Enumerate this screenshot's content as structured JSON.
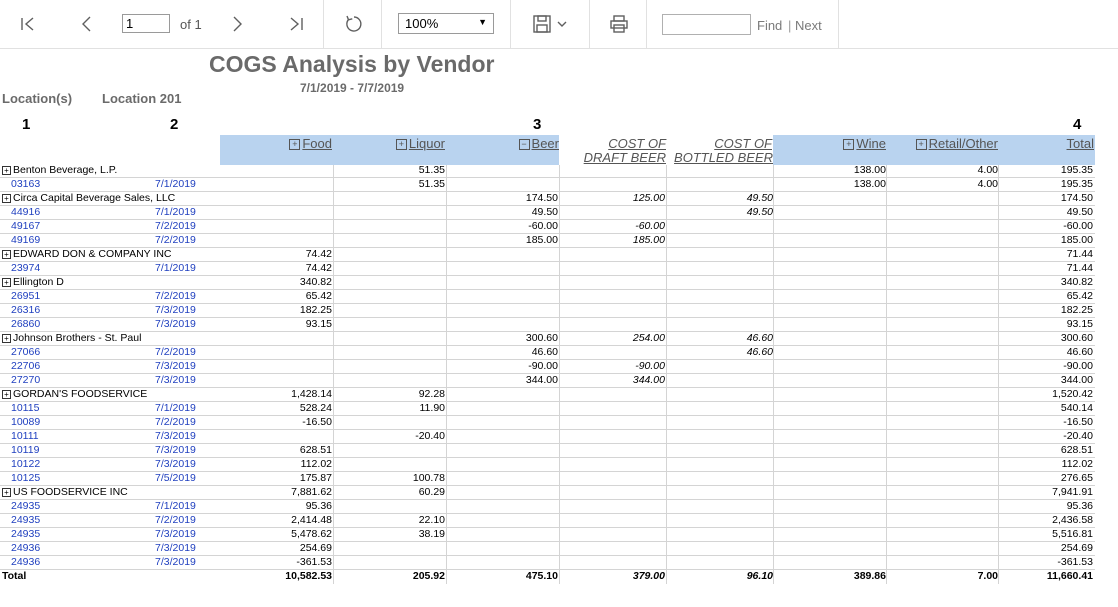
{
  "toolbar": {
    "page_value": "1",
    "of_label": "of 1",
    "zoom_value": "100%",
    "find_label": "Find",
    "separator": "|",
    "next_label": "Next"
  },
  "report": {
    "title": "COGS Analysis by Vendor",
    "daterange": "7/1/2019 - 7/7/2019",
    "location_label": "Location(s)",
    "location_value": "Location  201",
    "callouts": [
      "1",
      "2",
      "3",
      "4"
    ]
  },
  "columns": {
    "food": "Food",
    "liquor": "Liquor",
    "beer": "Beer",
    "draft_line1": "COST OF",
    "draft_line2": "DRAFT BEER",
    "bottled_line1": "COST OF",
    "bottled_line2": "BOTTLED BEER",
    "wine": "Wine",
    "retail": "Retail/Other",
    "total": "Total",
    "plus": "+",
    "minus": "−"
  },
  "rows": [
    {
      "kind": "vendor",
      "label": "Benton Beverage, L.P.",
      "food": "",
      "liquor": "51.35",
      "beer": "",
      "draft": "",
      "bottled": "",
      "wine": "138.00",
      "retail": "4.00",
      "total": "195.35"
    },
    {
      "kind": "detail",
      "doc": "03163",
      "date": "7/1/2019",
      "food": "",
      "liquor": "51.35",
      "beer": "",
      "draft": "",
      "bottled": "",
      "wine": "138.00",
      "retail": "4.00",
      "total": "195.35"
    },
    {
      "kind": "vendor",
      "label": "Circa Capital Beverage Sales, LLC",
      "food": "",
      "liquor": "",
      "beer": "174.50",
      "draft": "125.00",
      "bottled": "49.50",
      "wine": "",
      "retail": "",
      "total": "174.50"
    },
    {
      "kind": "detail",
      "doc": "44916",
      "date": "7/1/2019",
      "food": "",
      "liquor": "",
      "beer": "49.50",
      "draft": "",
      "bottled": "49.50",
      "wine": "",
      "retail": "",
      "total": "49.50"
    },
    {
      "kind": "detail",
      "doc": "49167",
      "date": "7/2/2019",
      "food": "",
      "liquor": "",
      "beer": "-60.00",
      "draft": "-60.00",
      "bottled": "",
      "wine": "",
      "retail": "",
      "total": "-60.00"
    },
    {
      "kind": "detail",
      "doc": "49169",
      "date": "7/2/2019",
      "food": "",
      "liquor": "",
      "beer": "185.00",
      "draft": "185.00",
      "bottled": "",
      "wine": "",
      "retail": "",
      "total": "185.00"
    },
    {
      "kind": "vendor",
      "label": "EDWARD DON & COMPANY INC",
      "food": "74.42",
      "liquor": "",
      "beer": "",
      "draft": "",
      "bottled": "",
      "wine": "",
      "retail": "",
      "total": "71.44"
    },
    {
      "kind": "detail",
      "doc": "23974",
      "date": "7/1/2019",
      "food": "74.42",
      "liquor": "",
      "beer": "",
      "draft": "",
      "bottled": "",
      "wine": "",
      "retail": "",
      "total": "71.44"
    },
    {
      "kind": "vendor",
      "label": "Ellington D",
      "food": "340.82",
      "liquor": "",
      "beer": "",
      "draft": "",
      "bottled": "",
      "wine": "",
      "retail": "",
      "total": "340.82"
    },
    {
      "kind": "detail",
      "doc": "26951",
      "date": "7/2/2019",
      "food": "65.42",
      "liquor": "",
      "beer": "",
      "draft": "",
      "bottled": "",
      "wine": "",
      "retail": "",
      "total": "65.42"
    },
    {
      "kind": "detail",
      "doc": "26316",
      "date": "7/3/2019",
      "food": "182.25",
      "liquor": "",
      "beer": "",
      "draft": "",
      "bottled": "",
      "wine": "",
      "retail": "",
      "total": "182.25"
    },
    {
      "kind": "detail",
      "doc": "26860",
      "date": "7/3/2019",
      "food": "93.15",
      "liquor": "",
      "beer": "",
      "draft": "",
      "bottled": "",
      "wine": "",
      "retail": "",
      "total": "93.15"
    },
    {
      "kind": "vendor",
      "label": "Johnson Brothers - St. Paul",
      "food": "",
      "liquor": "",
      "beer": "300.60",
      "draft": "254.00",
      "bottled": "46.60",
      "wine": "",
      "retail": "",
      "total": "300.60"
    },
    {
      "kind": "detail",
      "doc": "27066",
      "date": "7/2/2019",
      "food": "",
      "liquor": "",
      "beer": "46.60",
      "draft": "",
      "bottled": "46.60",
      "wine": "",
      "retail": "",
      "total": "46.60"
    },
    {
      "kind": "detail",
      "doc": "22706",
      "date": "7/3/2019",
      "food": "",
      "liquor": "",
      "beer": "-90.00",
      "draft": "-90.00",
      "bottled": "",
      "wine": "",
      "retail": "",
      "total": "-90.00"
    },
    {
      "kind": "detail",
      "doc": "27270",
      "date": "7/3/2019",
      "food": "",
      "liquor": "",
      "beer": "344.00",
      "draft": "344.00",
      "bottled": "",
      "wine": "",
      "retail": "",
      "total": "344.00"
    },
    {
      "kind": "vendor",
      "label": "GORDAN'S FOODSERVICE",
      "food": "1,428.14",
      "liquor": "92.28",
      "beer": "",
      "draft": "",
      "bottled": "",
      "wine": "",
      "retail": "",
      "total": "1,520.42"
    },
    {
      "kind": "detail",
      "doc": "10115",
      "date": "7/1/2019",
      "food": "528.24",
      "liquor": "11.90",
      "beer": "",
      "draft": "",
      "bottled": "",
      "wine": "",
      "retail": "",
      "total": "540.14"
    },
    {
      "kind": "detail",
      "doc": "10089",
      "date": "7/2/2019",
      "food": "-16.50",
      "liquor": "",
      "beer": "",
      "draft": "",
      "bottled": "",
      "wine": "",
      "retail": "",
      "total": "-16.50"
    },
    {
      "kind": "detail",
      "doc": "10111",
      "date": "7/3/2019",
      "food": "",
      "liquor": "-20.40",
      "beer": "",
      "draft": "",
      "bottled": "",
      "wine": "",
      "retail": "",
      "total": "-20.40"
    },
    {
      "kind": "detail",
      "doc": "10119",
      "date": "7/3/2019",
      "food": "628.51",
      "liquor": "",
      "beer": "",
      "draft": "",
      "bottled": "",
      "wine": "",
      "retail": "",
      "total": "628.51"
    },
    {
      "kind": "detail",
      "doc": "10122",
      "date": "7/3/2019",
      "food": "112.02",
      "liquor": "",
      "beer": "",
      "draft": "",
      "bottled": "",
      "wine": "",
      "retail": "",
      "total": "112.02"
    },
    {
      "kind": "detail",
      "doc": "10125",
      "date": "7/5/2019",
      "food": "175.87",
      "liquor": "100.78",
      "beer": "",
      "draft": "",
      "bottled": "",
      "wine": "",
      "retail": "",
      "total": "276.65"
    },
    {
      "kind": "vendor",
      "label": "US FOODSERVICE INC",
      "food": "7,881.62",
      "liquor": "60.29",
      "beer": "",
      "draft": "",
      "bottled": "",
      "wine": "",
      "retail": "",
      "total": "7,941.91"
    },
    {
      "kind": "detail",
      "doc": "24935",
      "date": "7/1/2019",
      "food": "95.36",
      "liquor": "",
      "beer": "",
      "draft": "",
      "bottled": "",
      "wine": "",
      "retail": "",
      "total": "95.36"
    },
    {
      "kind": "detail",
      "doc": "24935",
      "date": "7/2/2019",
      "food": "2,414.48",
      "liquor": "22.10",
      "beer": "",
      "draft": "",
      "bottled": "",
      "wine": "",
      "retail": "",
      "total": "2,436.58"
    },
    {
      "kind": "detail",
      "doc": "24935",
      "date": "7/3/2019",
      "food": "5,478.62",
      "liquor": "38.19",
      "beer": "",
      "draft": "",
      "bottled": "",
      "wine": "",
      "retail": "",
      "total": "5,516.81"
    },
    {
      "kind": "detail",
      "doc": "24936",
      "date": "7/3/2019",
      "food": "254.69",
      "liquor": "",
      "beer": "",
      "draft": "",
      "bottled": "",
      "wine": "",
      "retail": "",
      "total": "254.69"
    },
    {
      "kind": "detail",
      "doc": "24936",
      "date": "7/3/2019",
      "food": "-361.53",
      "liquor": "",
      "beer": "",
      "draft": "",
      "bottled": "",
      "wine": "",
      "retail": "",
      "total": "-361.53"
    }
  ],
  "totals": {
    "label": "Total",
    "food": "10,582.53",
    "liquor": "205.92",
    "beer": "475.10",
    "draft": "379.00",
    "bottled": "96.10",
    "wine": "389.86",
    "retail": "7.00",
    "total": "11,660.41"
  }
}
